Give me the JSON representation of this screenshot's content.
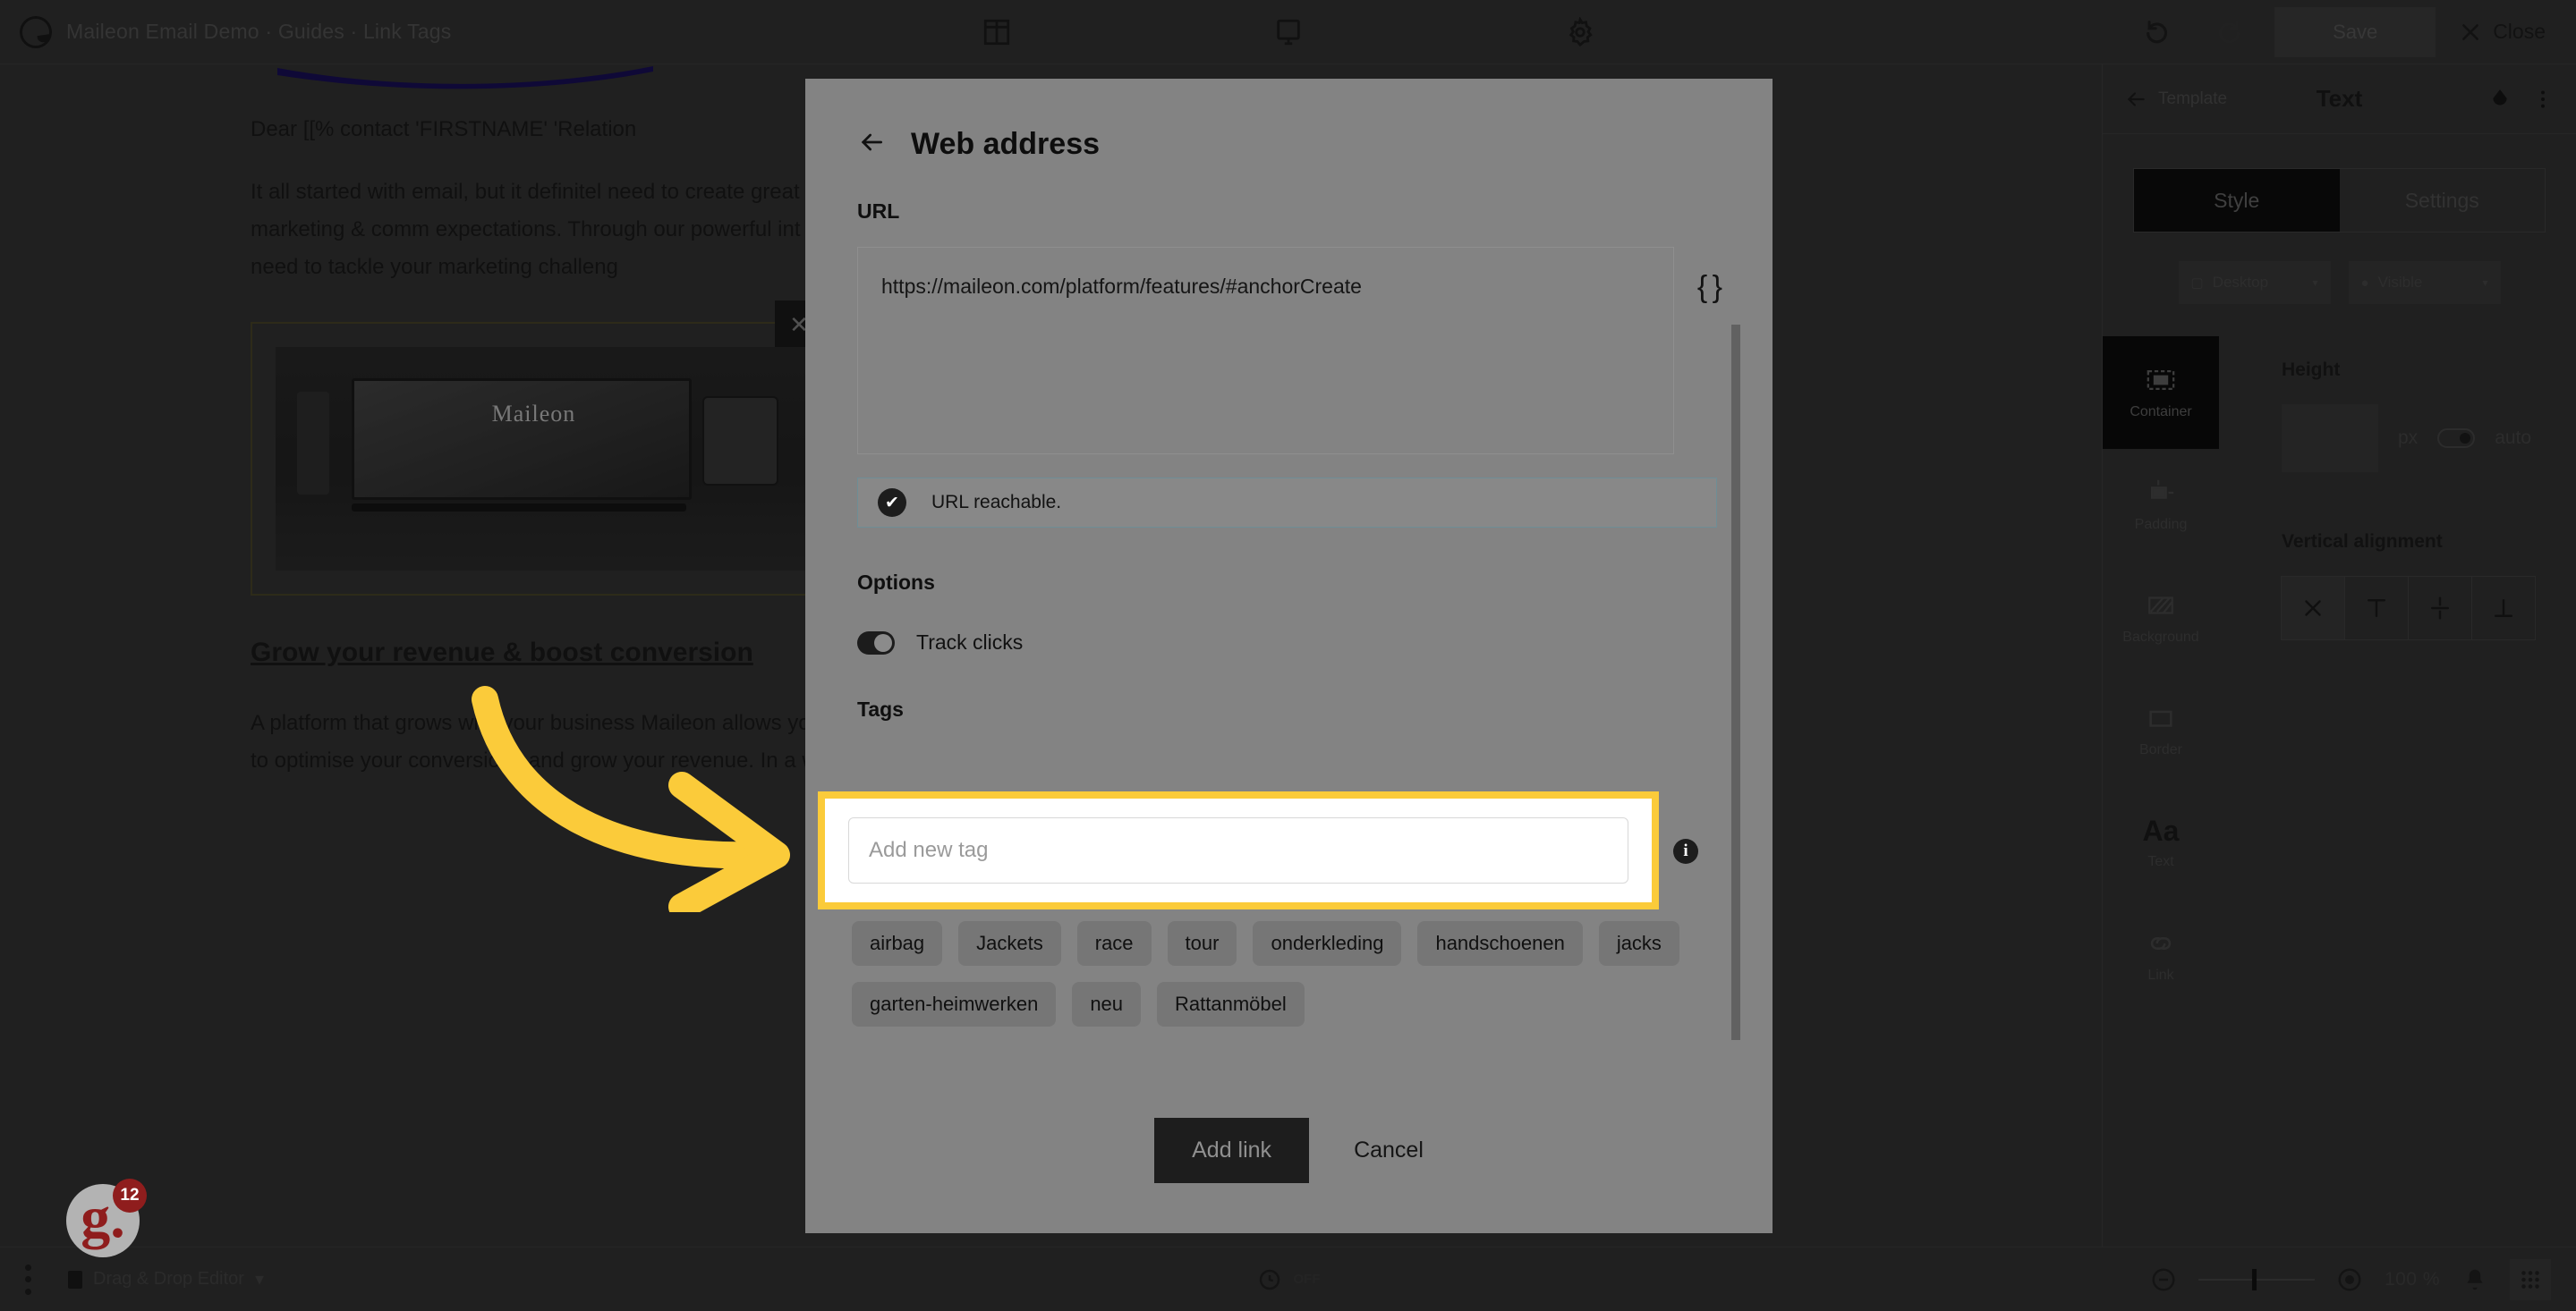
{
  "topbar": {
    "brand_logo": "maileon-logo-icon",
    "title": "Maileon Email Demo · Guides · Link Tags",
    "center_icons": [
      "blocks-layout-icon",
      "desktop-preview-icon",
      "gear-settings-icon"
    ],
    "undo_icon": "undo-icon",
    "redo_icon": "redo-icon",
    "save_label": "Save",
    "close_label": "Close",
    "close_icon": "close-x-icon"
  },
  "email": {
    "greeting": "Dear [[% contact 'FIRSTNAME' 'Relation",
    "paragraph1": "It all started with email, but it definitel need to create great marketing & comm expectations. Through our powerful int need to tackle your marketing challeng",
    "image_caption": "Maileon",
    "image_close_icon": "close-x-icon",
    "heading": "Grow your revenue & boost conversion",
    "paragraph2": "A platform that grows with your business Maileon allows you to optimise your conversions and grow your revenue. In a w"
  },
  "right_panel": {
    "back_label": "Template",
    "back_icon": "arrow-left-icon",
    "title": "Text",
    "theme_icon": "color-theme-icon",
    "menu_icon": "kebab-menu-icon",
    "tabs": [
      {
        "label": "Style",
        "active": true
      },
      {
        "label": "Settings",
        "active": false
      }
    ],
    "device_dropdown": {
      "label": "Desktop",
      "icon": "monitor-icon",
      "caret": "▾"
    },
    "visibility_dropdown": {
      "label": "Visible",
      "icon": "eye-icon",
      "caret": "▾"
    },
    "rail": [
      {
        "label": "Container",
        "icon": "container-icon",
        "active": true
      },
      {
        "label": "Padding",
        "icon": "padding-icon",
        "active": false
      },
      {
        "label": "Background",
        "icon": "background-icon",
        "active": false
      },
      {
        "label": "Border",
        "icon": "border-icon",
        "active": false
      },
      {
        "label": "Text",
        "icon": "text-aa-icon",
        "active": false
      },
      {
        "label": "Link",
        "icon": "link-chain-icon",
        "active": false
      }
    ],
    "height": {
      "label": "Height",
      "value": "",
      "unit": "px",
      "auto_label": "auto"
    },
    "vertical_alignment": {
      "label": "Vertical alignment",
      "options": [
        "none-x-icon",
        "align-top-icon",
        "align-middle-icon",
        "align-bottom-icon"
      ],
      "active_index": 0
    }
  },
  "modal": {
    "back_icon": "arrow-left-icon",
    "title": "Web address",
    "url_label": "URL",
    "url_value": "https://maileon.com/platform/features/#anchorCreate",
    "personalize_icon": "curly-braces-icon",
    "notice": {
      "icon": "check-circle-icon",
      "text": "URL reachable."
    },
    "options_label": "Options",
    "track_clicks_label": "Track clicks",
    "track_clicks_on": true,
    "tags_label": "Tags",
    "tag_input_placeholder": "Add new tag",
    "tag_input_value": "",
    "info_icon": "info-icon",
    "tags": [
      "airbag",
      "Jackets",
      "race",
      "tour",
      "onderkleding",
      "handschoenen",
      "jacks",
      "garten-heimwerken",
      "neu",
      "Rattanmöbel"
    ],
    "primary_button": "Add link",
    "secondary_button": "Cancel"
  },
  "annotation": {
    "arrow_color": "#fbcb3a",
    "highlight_color": "#fbcb3a"
  },
  "bottombar": {
    "menu_icon": "kebab-menu-icon",
    "mode_label": "Drag & Drop Editor",
    "mode_caret": "▾",
    "history_icon": "history-clock-icon",
    "history_label": "OFF",
    "zoom_out_icon": "zoom-out-icon",
    "zoom_reset_icon": "zoom-target-icon",
    "zoom_value": "100 %",
    "notification_icon": "bell-icon",
    "apps_icon": "apps-grid-icon"
  },
  "badge": {
    "logo_text": "g.",
    "count": "12"
  }
}
